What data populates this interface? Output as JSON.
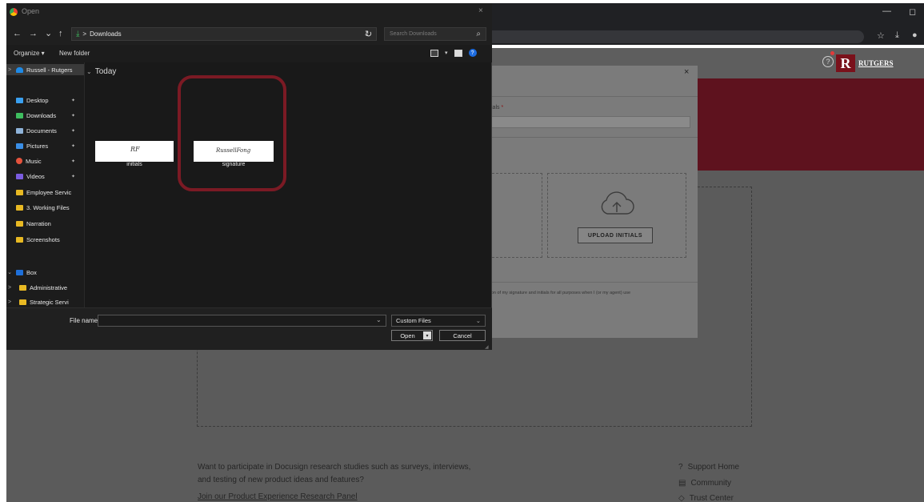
{
  "browser": {
    "minimize_glyph": "—",
    "restore_glyph": "◻",
    "star_icon": "☆",
    "download_icon": "⤓",
    "profile_icon": "●"
  },
  "header": {
    "help_glyph": "?",
    "logo_letter": "R",
    "logo_text": "RUTGERS"
  },
  "modal": {
    "close_glyph": "×",
    "initials_label": "ials",
    "required_mark": "*",
    "upload_initials_button": "UPLOAD INITIALS",
    "legal_text": "ation of my signature and initials for all purposes when I (or my agent) use"
  },
  "footer": {
    "research_line1": "Want to participate in Docusign research studies such as surveys, interviews,",
    "research_line2": "and testing of new product ideas and features?",
    "research_link": "Join our Product Experience Research Panel",
    "links": [
      {
        "icon": "?",
        "label": "Support Home"
      },
      {
        "icon": "▤",
        "label": "Community"
      },
      {
        "icon": "◇",
        "label": "Trust Center"
      }
    ]
  },
  "dialog": {
    "title": "Open",
    "close_glyph": "×",
    "nav": {
      "back": "←",
      "forward": "→",
      "recent": "⌄",
      "up": "↑"
    },
    "path": {
      "icon": "⤓",
      "separator": ">",
      "folder": "Downloads"
    },
    "path_dropdown": "⌄",
    "refresh_glyph": "↻",
    "search_placeholder": "Search Downloads",
    "search_glyph": "⌕",
    "organize": "Organize ▾",
    "new_folder": "New folder",
    "view_dropdown": "▾",
    "help_glyph": "?",
    "nav_pane": [
      {
        "label": "Russell - Rutgers",
        "color": "#1e8ae6",
        "chevron": ">",
        "pinned": false,
        "selected": true
      },
      {
        "label": "Desktop",
        "color": "#3aa0f0",
        "chevron": "",
        "pinned": true,
        "selected": false
      },
      {
        "label": "Downloads",
        "color": "#3ebd5f",
        "chevron": "",
        "pinned": true,
        "selected": false
      },
      {
        "label": "Documents",
        "color": "#8fb3d9",
        "chevron": "",
        "pinned": true,
        "selected": false
      },
      {
        "label": "Pictures",
        "color": "#3a8ee6",
        "chevron": "",
        "pinned": true,
        "selected": false
      },
      {
        "label": "Music",
        "color": "#e5533d",
        "chevron": "",
        "pinned": true,
        "selected": false
      },
      {
        "label": "Videos",
        "color": "#7b5ce0",
        "chevron": "",
        "pinned": true,
        "selected": false
      },
      {
        "label": "Employee Servic",
        "color": "#e8b923",
        "chevron": "",
        "pinned": false,
        "selected": false
      },
      {
        "label": "3. Working Files",
        "color": "#e8b923",
        "chevron": "",
        "pinned": false,
        "selected": false
      },
      {
        "label": "Narration",
        "color": "#e8b923",
        "chevron": "",
        "pinned": false,
        "selected": false
      },
      {
        "label": "Screenshots",
        "color": "#e8b923",
        "chevron": "",
        "pinned": false,
        "selected": false
      },
      {
        "label": "Box",
        "color": "#1e6fd9",
        "chevron": "⌄",
        "pinned": false,
        "selected": false
      },
      {
        "label": "Administrative",
        "color": "#e8b923",
        "chevron": ">",
        "pinned": false,
        "selected": false
      },
      {
        "label": "Strategic Servi",
        "color": "#e8b923",
        "chevron": ">",
        "pinned": false,
        "selected": false
      }
    ],
    "group_chevron": "⌄",
    "group_header": "Today",
    "files": [
      {
        "name": "initials",
        "thumb_text": "RF"
      },
      {
        "name": "signature",
        "thumb_text": "RussellFong"
      }
    ],
    "file_name_label": "File name:",
    "file_name_value": "",
    "file_name_chevron": "⌄",
    "file_type": "Custom Files",
    "file_type_chevron": "⌄",
    "open_label": "Open",
    "open_split": "▾",
    "cancel_label": "Cancel",
    "grip": "◢"
  },
  "colors": {
    "highlight": "#7b1a24",
    "rutgers_red": "#7a111b"
  }
}
